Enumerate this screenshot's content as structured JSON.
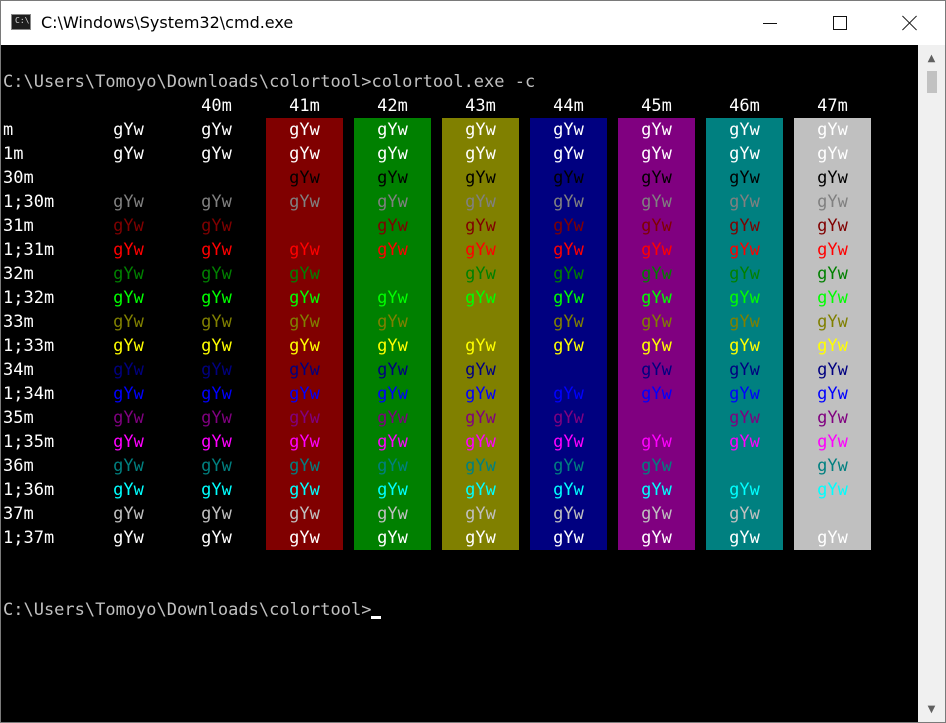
{
  "window": {
    "title": "C:\\Windows\\System32\\cmd.exe",
    "icon": "cmd-icon",
    "icon_text": "C:\\"
  },
  "controls": {
    "minimize": "minimize-icon",
    "maximize": "maximize-icon",
    "close": "close-icon"
  },
  "console": {
    "command_line": "C:\\Users\\Tomoyo\\Downloads\\colortool>colortool.exe -c",
    "prompt_line": "C:\\Users\\Tomoyo\\Downloads\\colortool>",
    "sample_text": "gYw",
    "headers": [
      "",
      "",
      "40m",
      "41m",
      "42m",
      "43m",
      "44m",
      "45m",
      "46m",
      "47m"
    ],
    "backgrounds": [
      "#000000",
      "#000000",
      "#000000",
      "#800000",
      "#008000",
      "#808000",
      "#000080",
      "#800080",
      "#008080",
      "#c0c0c0"
    ],
    "rows": [
      {
        "label": "m",
        "fg": "#ffffff"
      },
      {
        "label": "1m",
        "fg": "#ffffff"
      },
      {
        "label": "30m",
        "fg": "#000000"
      },
      {
        "label": "1;30m",
        "fg": "#808080"
      },
      {
        "label": "31m",
        "fg": "#800000"
      },
      {
        "label": "1;31m",
        "fg": "#ff0000"
      },
      {
        "label": "32m",
        "fg": "#008000"
      },
      {
        "label": "1;32m",
        "fg": "#00ff00"
      },
      {
        "label": "33m",
        "fg": "#808000"
      },
      {
        "label": "1;33m",
        "fg": "#ffff00"
      },
      {
        "label": "34m",
        "fg": "#000080"
      },
      {
        "label": "1;34m",
        "fg": "#0000ff"
      },
      {
        "label": "35m",
        "fg": "#800080"
      },
      {
        "label": "1;35m",
        "fg": "#ff00ff"
      },
      {
        "label": "36m",
        "fg": "#008080"
      },
      {
        "label": "1;36m",
        "fg": "#00ffff"
      },
      {
        "label": "37m",
        "fg": "#c0c0c0"
      },
      {
        "label": "1;37m",
        "fg": "#ffffff"
      }
    ]
  },
  "colors": {
    "console_background": "#000000",
    "console_text": "#c0c0c0",
    "titlebar": "#ffffff",
    "scrollbar": "#f0f0f0",
    "scrollbar_thumb": "#c2c2c2"
  }
}
